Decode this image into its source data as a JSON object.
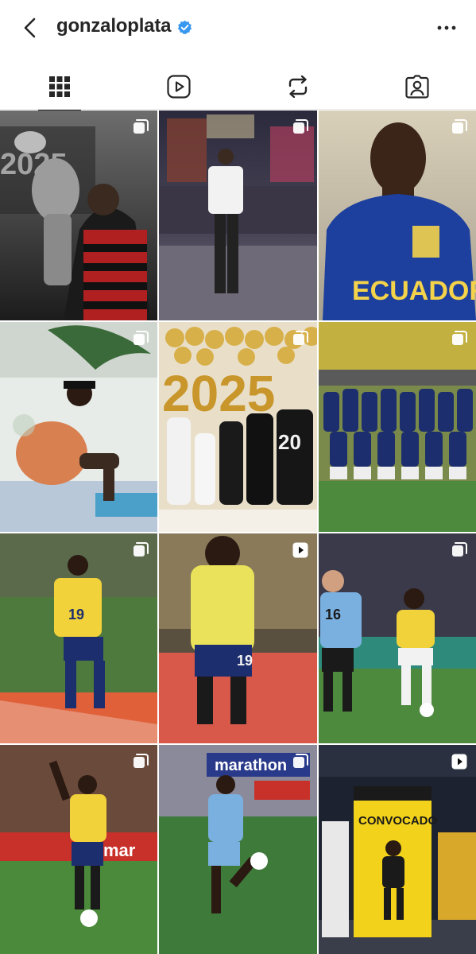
{
  "header": {
    "username": "gonzaloplata",
    "verified_icon": "verified-badge-icon",
    "back_icon": "chevron-left-icon",
    "more_icon": "more-horizontal-icon",
    "accent": "#3897f0"
  },
  "tabs": [
    {
      "name": "posts",
      "icon": "grid-icon",
      "active": true
    },
    {
      "name": "reels",
      "icon": "reels-icon",
      "active": false
    },
    {
      "name": "reposts",
      "icon": "repost-icon",
      "active": false
    },
    {
      "name": "tagged",
      "icon": "tagged-icon",
      "active": false
    }
  ],
  "posts": [
    {
      "subject": "player-holding-trophy",
      "type": "carousel",
      "text": "2025"
    },
    {
      "subject": "player-city-street-night",
      "type": "carousel"
    },
    {
      "subject": "player-ecuador-jacket",
      "type": "carousel",
      "text": "ECUADOR"
    },
    {
      "subject": "player-sitting-poolside",
      "type": "carousel"
    },
    {
      "subject": "family-2025-balloons",
      "type": "carousel",
      "text": "20"
    },
    {
      "subject": "team-photo-stadium",
      "type": "carousel"
    },
    {
      "subject": "player-celebrating-19",
      "type": "carousel",
      "text": "19"
    },
    {
      "subject": "player-back-19",
      "type": "reel",
      "text": "19"
    },
    {
      "subject": "player-dribbling-ball",
      "type": "carousel",
      "text": "16"
    },
    {
      "subject": "player-waving-stadium",
      "type": "carousel",
      "text": "marathon"
    },
    {
      "subject": "player-training-ball",
      "type": "carousel",
      "text": "marathon"
    },
    {
      "subject": "convocado-billboard",
      "type": "reel",
      "text": "CONVOCADO"
    }
  ]
}
